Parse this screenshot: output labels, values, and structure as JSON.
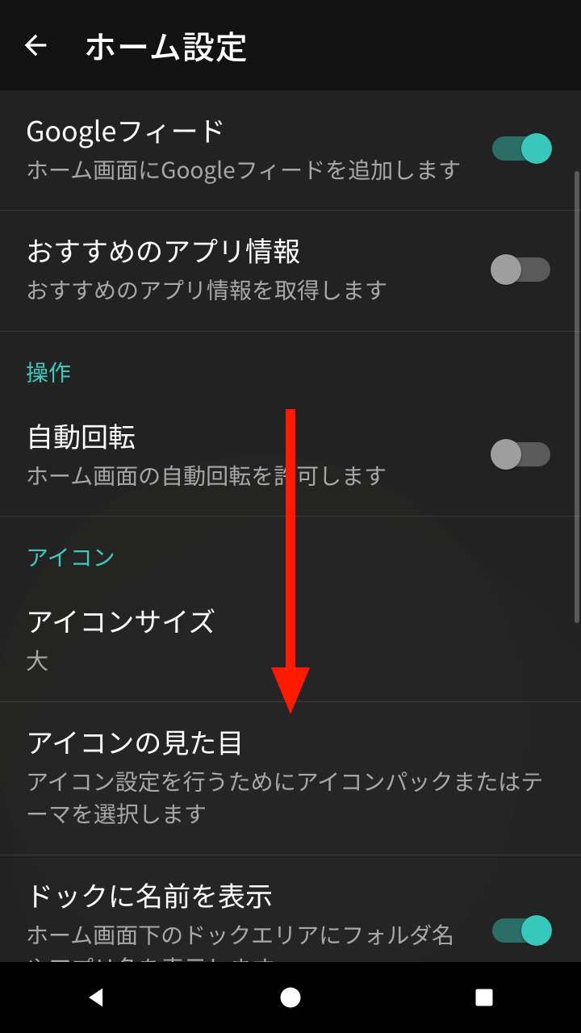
{
  "appbar": {
    "title": "ホーム設定"
  },
  "sections": {
    "feed": {
      "google_feed": {
        "title": "Googleフィード",
        "sub": "ホーム画面にGoogleフィードを追加します",
        "on": true
      },
      "recommended": {
        "title": "おすすめのアプリ情報",
        "sub": "おすすめのアプリ情報を取得します",
        "on": false
      }
    },
    "operation_header": "操作",
    "operation": {
      "autorotate": {
        "title": "自動回転",
        "sub": "ホーム画面の自動回転を許可します",
        "on": false
      }
    },
    "icon_header": "アイコン",
    "icon": {
      "size": {
        "title": "アイコンサイズ",
        "value": "大"
      },
      "look": {
        "title": "アイコンの見た目",
        "sub": "アイコン設定を行うためにアイコンパックまたはテーマを選択します"
      },
      "dockname": {
        "title": "ドックに名前を表示",
        "sub": "ホーム画面下のドックエリアにフォルダ名やアプリ名を表示します",
        "on": true
      }
    }
  },
  "colors": {
    "accent": "#37c8bb"
  }
}
